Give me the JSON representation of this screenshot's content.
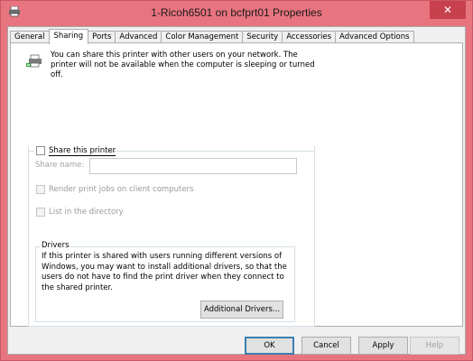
{
  "window": {
    "title": "1-Ricoh6501 on bcfprt01 Properties",
    "close_label": "✕",
    "accent_color": "#e8747f"
  },
  "tabs": [
    {
      "label": "General"
    },
    {
      "label": "Sharing"
    },
    {
      "label": "Ports"
    },
    {
      "label": "Advanced"
    },
    {
      "label": "Color Management"
    },
    {
      "label": "Security"
    },
    {
      "label": "Accessories"
    },
    {
      "label": "Advanced Options"
    }
  ],
  "active_tab": "Sharing",
  "sharing": {
    "intro": "You can share this printer with other users on your network. The printer will not be available when the computer is sleeping or turned off.",
    "share_printer": {
      "label": "Share this printer",
      "checked": false
    },
    "share_name": {
      "label": "Share name:",
      "value": ""
    },
    "render_jobs": {
      "label": "Render print jobs on client computers",
      "checked": false
    },
    "list_directory": {
      "label": "List in the directory",
      "checked": false
    },
    "drivers": {
      "legend": "Drivers",
      "text": "If this printer is shared with users running different versions of Windows, you may want to install additional drivers, so that the users do not have to find the print driver when they connect to the shared printer.",
      "additional_drivers_label": "Additional Drivers..."
    }
  },
  "footer": {
    "ok_label": "OK",
    "cancel_label": "Cancel",
    "apply_label": "Apply",
    "help_label": "Help"
  },
  "icons": {
    "app": "printer-icon",
    "sharing": "shared-printer-icon"
  }
}
